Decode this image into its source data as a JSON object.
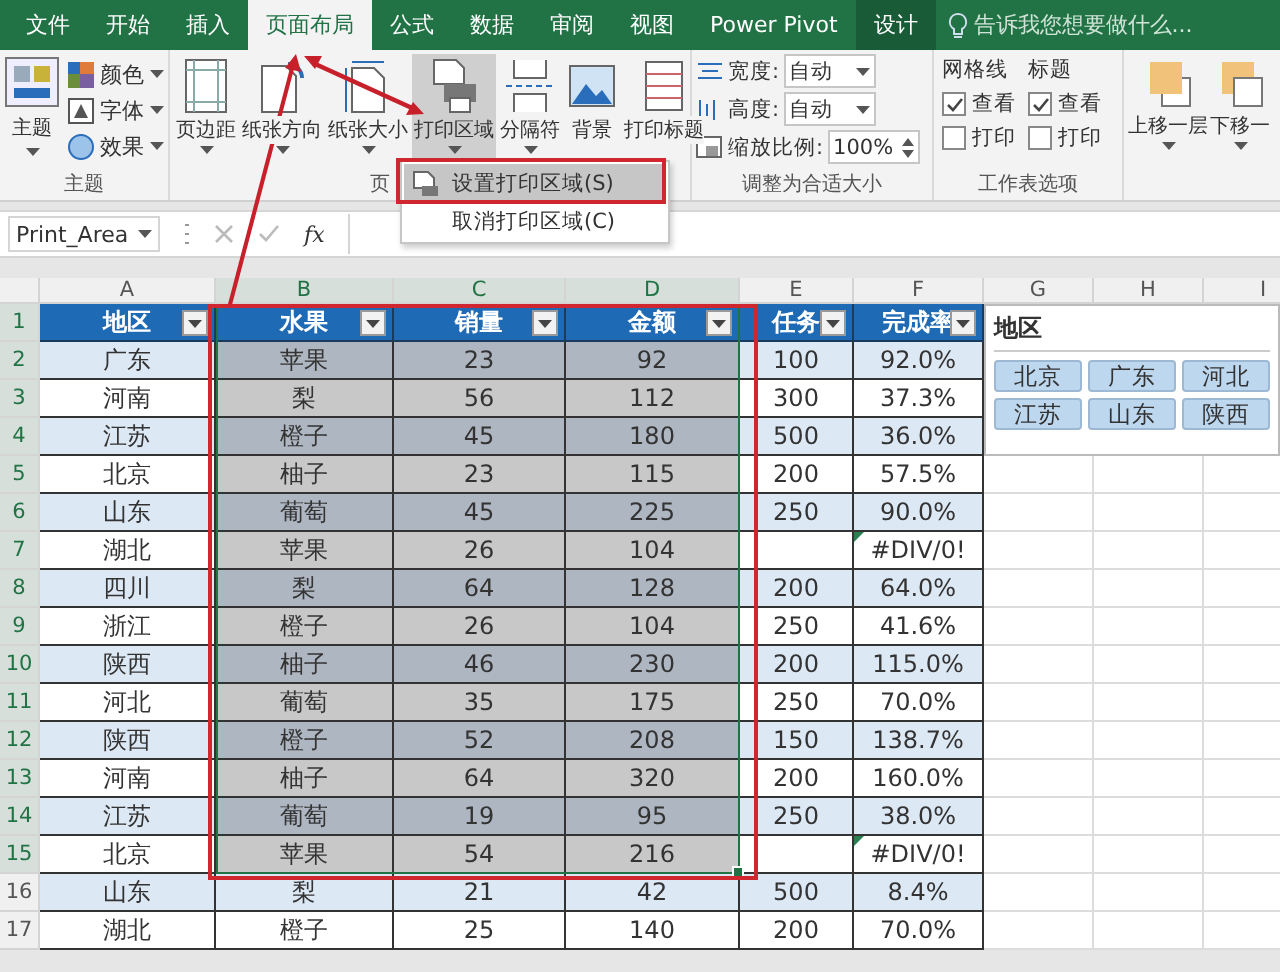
{
  "tabs": [
    {
      "label": "文件",
      "selected": false,
      "kind": "normal"
    },
    {
      "label": "开始",
      "selected": false,
      "kind": "normal"
    },
    {
      "label": "插入",
      "selected": false,
      "kind": "normal"
    },
    {
      "label": "页面布局",
      "selected": true,
      "kind": "normal"
    },
    {
      "label": "公式",
      "selected": false,
      "kind": "normal"
    },
    {
      "label": "数据",
      "selected": false,
      "kind": "normal"
    },
    {
      "label": "审阅",
      "selected": false,
      "kind": "normal"
    },
    {
      "label": "视图",
      "selected": false,
      "kind": "normal"
    },
    {
      "label": "Power Pivot",
      "selected": false,
      "kind": "normal"
    },
    {
      "label": "设计",
      "selected": false,
      "kind": "contextual"
    }
  ],
  "tell_me": {
    "placeholder": "告诉我您想要做什么..."
  },
  "ribbon": {
    "themes": {
      "label": "主题",
      "button": "主题",
      "items": [
        {
          "label": "颜色",
          "kind": "colors"
        },
        {
          "label": "字体",
          "kind": "fonts"
        },
        {
          "label": "效果",
          "kind": "effects"
        }
      ]
    },
    "page_setup": {
      "label": "页",
      "buttons": [
        {
          "label": "页边距",
          "kind": "margins",
          "has_menu": true,
          "selected": false
        },
        {
          "label": "纸张方向",
          "kind": "orientation",
          "has_menu": true,
          "selected": false
        },
        {
          "label": "纸张大小",
          "kind": "size",
          "has_menu": true,
          "selected": false
        },
        {
          "label": "打印区域",
          "kind": "print_area",
          "has_menu": true,
          "selected": true
        },
        {
          "label": "分隔符",
          "kind": "breaks",
          "has_menu": true,
          "selected": false
        },
        {
          "label": "背景",
          "kind": "background",
          "has_menu": false,
          "selected": false
        },
        {
          "label": "打印标题",
          "kind": "titles",
          "has_menu": false,
          "selected": false
        }
      ]
    },
    "scale": {
      "label": "调整为合适大小",
      "fields": [
        {
          "label": "宽度:",
          "value": "自动",
          "kind": "width"
        },
        {
          "label": "高度:",
          "value": "自动",
          "kind": "height"
        },
        {
          "label": "缩放比例:",
          "value": "100%",
          "kind": "scale"
        }
      ]
    },
    "sheet_options": {
      "label": "工作表选项",
      "columns": [
        {
          "heading": "网格线",
          "options": [
            {
              "label": "查看",
              "checked": true
            },
            {
              "label": "打印",
              "checked": false
            }
          ]
        },
        {
          "heading": "标题",
          "options": [
            {
              "label": "查看",
              "checked": true
            },
            {
              "label": "打印",
              "checked": false
            }
          ]
        }
      ]
    },
    "arrange": {
      "buttons": [
        {
          "label": "上移一层",
          "kind": "forward"
        },
        {
          "label": "下移一",
          "kind": "backward"
        }
      ]
    }
  },
  "print_area_menu": {
    "items": [
      {
        "label": "设置打印区域(S)",
        "selected": true
      },
      {
        "label": "取消打印区域(C)",
        "selected": false
      }
    ]
  },
  "formula_bar": {
    "name_box": "Print_Area",
    "function_label": "fx"
  },
  "sheet": {
    "columns": [
      {
        "label": "A",
        "selected": false
      },
      {
        "label": "B",
        "selected": true
      },
      {
        "label": "C",
        "selected": true
      },
      {
        "label": "D",
        "selected": true
      },
      {
        "label": "E",
        "selected": false
      },
      {
        "label": "F",
        "selected": false
      },
      {
        "label": "G",
        "selected": false
      },
      {
        "label": "H",
        "selected": false
      },
      {
        "label": "I",
        "selected": false
      }
    ],
    "header_row": {
      "row": "1",
      "selected": true,
      "cells": [
        "地区",
        "水果",
        "销量",
        "金额",
        "任务",
        "完成率"
      ]
    },
    "rows": [
      {
        "row": "2",
        "selected": true,
        "error_flag": false,
        "cells": [
          "广东",
          "苹果",
          "23",
          "92",
          "100",
          "92.0%"
        ]
      },
      {
        "row": "3",
        "selected": true,
        "error_flag": false,
        "cells": [
          "河南",
          "梨",
          "56",
          "112",
          "300",
          "37.3%"
        ]
      },
      {
        "row": "4",
        "selected": true,
        "error_flag": false,
        "cells": [
          "江苏",
          "橙子",
          "45",
          "180",
          "500",
          "36.0%"
        ]
      },
      {
        "row": "5",
        "selected": true,
        "error_flag": false,
        "cells": [
          "北京",
          "柚子",
          "23",
          "115",
          "200",
          "57.5%"
        ]
      },
      {
        "row": "6",
        "selected": true,
        "error_flag": false,
        "cells": [
          "山东",
          "葡萄",
          "45",
          "225",
          "250",
          "90.0%"
        ]
      },
      {
        "row": "7",
        "selected": true,
        "error_flag": true,
        "cells": [
          "湖北",
          "苹果",
          "26",
          "104",
          "",
          "#DIV/0!"
        ]
      },
      {
        "row": "8",
        "selected": true,
        "error_flag": false,
        "cells": [
          "四川",
          "梨",
          "64",
          "128",
          "200",
          "64.0%"
        ]
      },
      {
        "row": "9",
        "selected": true,
        "error_flag": false,
        "cells": [
          "浙江",
          "橙子",
          "26",
          "104",
          "250",
          "41.6%"
        ]
      },
      {
        "row": "10",
        "selected": true,
        "error_flag": false,
        "cells": [
          "陕西",
          "柚子",
          "46",
          "230",
          "200",
          "115.0%"
        ]
      },
      {
        "row": "11",
        "selected": true,
        "error_flag": false,
        "cells": [
          "河北",
          "葡萄",
          "35",
          "175",
          "250",
          "70.0%"
        ]
      },
      {
        "row": "12",
        "selected": true,
        "error_flag": false,
        "cells": [
          "陕西",
          "橙子",
          "52",
          "208",
          "150",
          "138.7%"
        ]
      },
      {
        "row": "13",
        "selected": true,
        "error_flag": false,
        "cells": [
          "河南",
          "柚子",
          "64",
          "320",
          "200",
          "160.0%"
        ]
      },
      {
        "row": "14",
        "selected": true,
        "error_flag": false,
        "cells": [
          "江苏",
          "葡萄",
          "19",
          "95",
          "250",
          "38.0%"
        ]
      },
      {
        "row": "15",
        "selected": true,
        "error_flag": true,
        "cells": [
          "北京",
          "苹果",
          "54",
          "216",
          "",
          "#DIV/0!"
        ]
      },
      {
        "row": "16",
        "selected": false,
        "error_flag": false,
        "cells": [
          "山东",
          "梨",
          "21",
          "42",
          "500",
          "8.4%"
        ]
      },
      {
        "row": "17",
        "selected": false,
        "error_flag": false,
        "cells": [
          "湖北",
          "橙子",
          "25",
          "140",
          "200",
          "70.0%"
        ]
      }
    ]
  },
  "slicer": {
    "title": "地区",
    "items": [
      {
        "label": "北京",
        "selected": true
      },
      {
        "label": "广东",
        "selected": true
      },
      {
        "label": "河北",
        "selected": true
      },
      {
        "label": "江苏",
        "selected": true
      },
      {
        "label": "山东",
        "selected": true
      },
      {
        "label": "陕西",
        "selected": true
      }
    ]
  }
}
